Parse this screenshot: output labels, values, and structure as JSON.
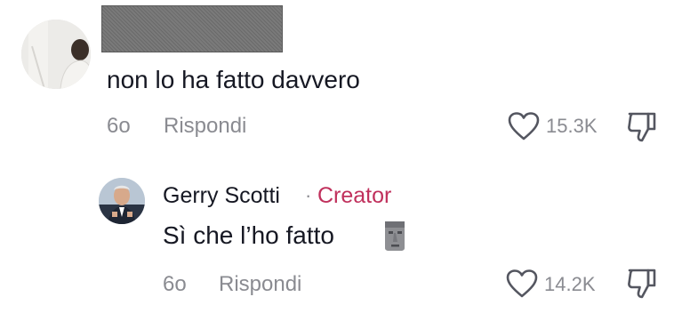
{
  "comments": [
    {
      "text": "non lo ha fatto davvero",
      "time": "6o",
      "reply_label": "Rispondi",
      "likes": "15.3K"
    }
  ],
  "reply": {
    "username": "Gerry Scotti",
    "separator": "·",
    "badge": "Creator",
    "text": "Sì che l’ho fatto",
    "emoji": "🗿",
    "time": "6o",
    "reply_label": "Rispondi",
    "likes": "14.2K"
  },
  "colors": {
    "creator_badge": "#c0305c",
    "meta_text": "#8a8b91",
    "primary_text": "#161823"
  },
  "icons": {
    "like": "heart-outline-icon",
    "dislike": "thumbs-down-outline-icon",
    "reaction": "moai-icon"
  }
}
